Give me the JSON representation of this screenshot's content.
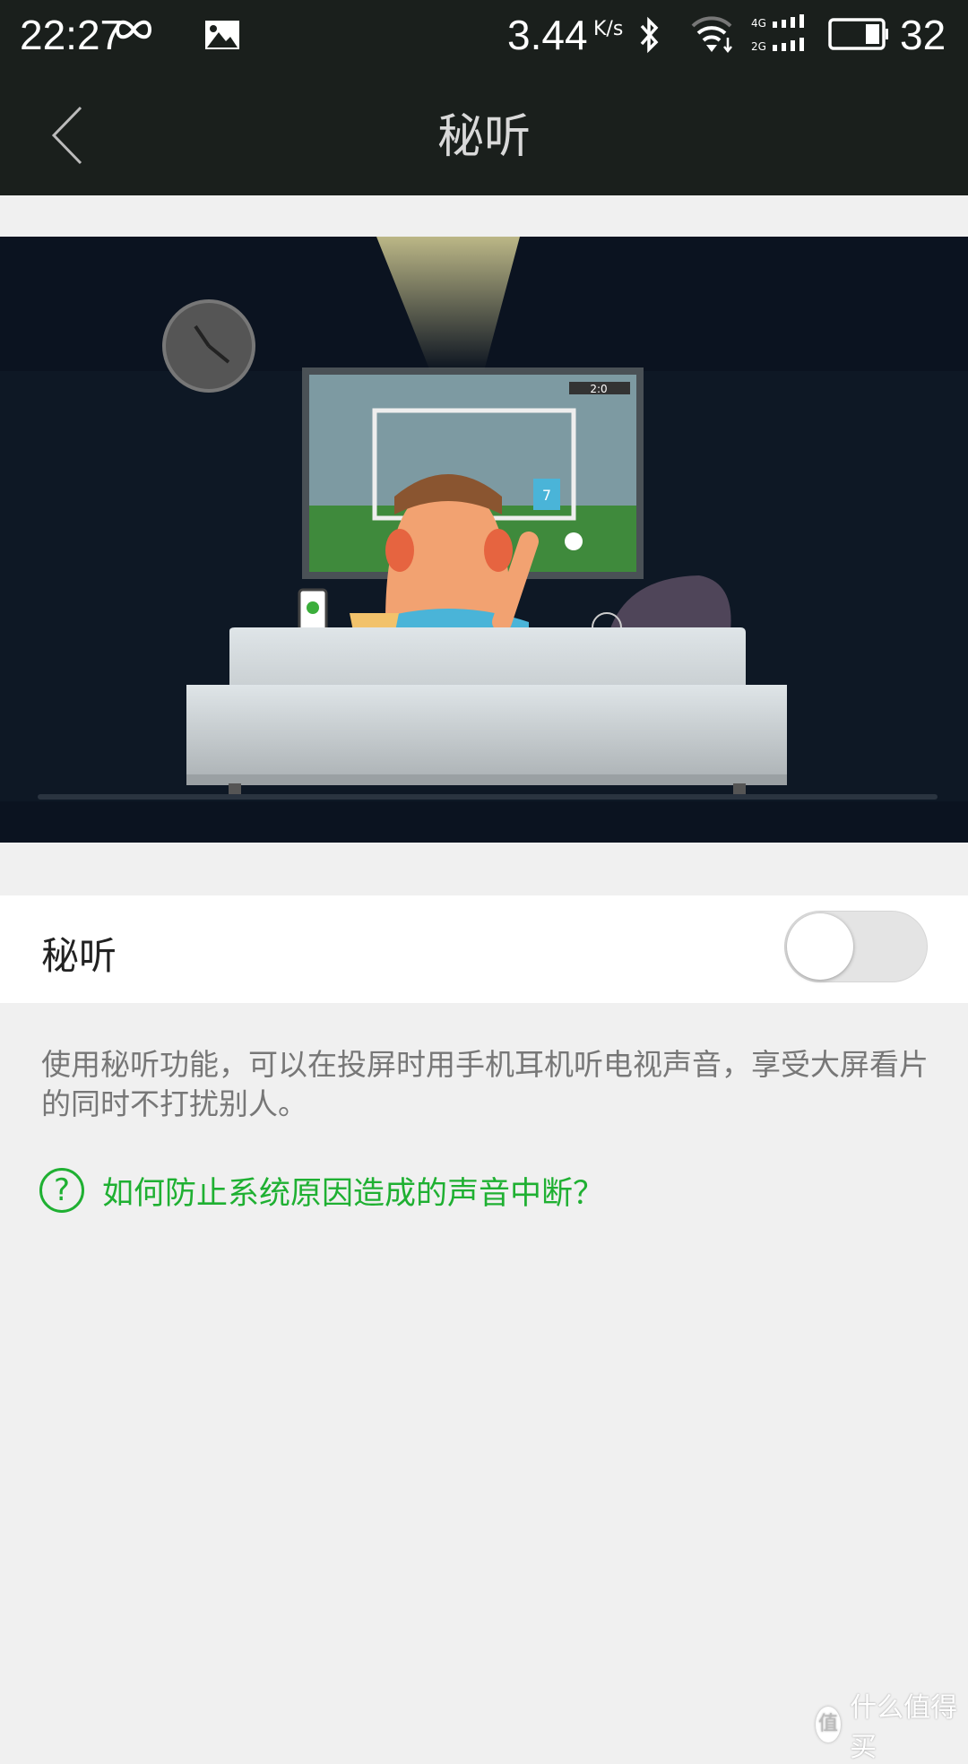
{
  "status_bar": {
    "time": "22:27",
    "net_speed": "3.44",
    "net_unit": "K/s",
    "network_1": "4G",
    "network_2": "2G",
    "battery": "32",
    "icons": [
      "infinity-icon",
      "image-icon",
      "bluetooth-icon",
      "wifi-icon",
      "signal-icon",
      "battery-icon"
    ]
  },
  "header": {
    "title": "秘听",
    "back_icon": "chevron-left-icon"
  },
  "setting": {
    "label": "秘听",
    "enabled": false
  },
  "description": "使用秘听功能，可以在投屏时用手机耳机听电视声音，享受大屏看片的同时不打扰别人。",
  "help_link": {
    "icon": "question-circle-icon",
    "text": "如何防止系统原因造成的声音中断？"
  },
  "illustration": {
    "scoreboard": "2:0",
    "jersey_number": "7"
  },
  "watermark": {
    "logo_char": "值",
    "text": "什么值得买"
  },
  "colors": {
    "bar": "#1a1f1c",
    "accent": "#1fb032",
    "background": "#f0f0f0"
  }
}
